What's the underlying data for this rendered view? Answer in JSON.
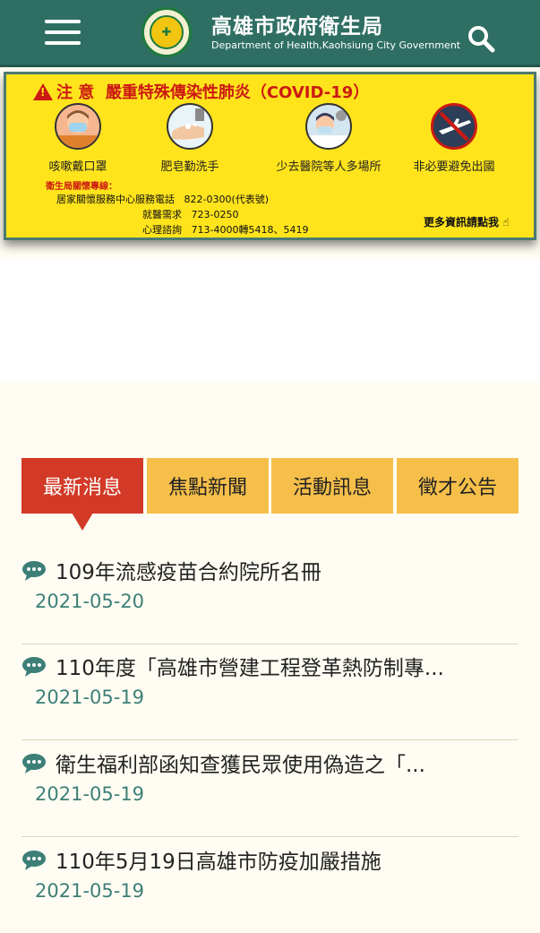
{
  "header": {
    "title": "高雄市政府衛生局",
    "subtitle": "Department of Health,Kaohsiung City Government",
    "menu_icon": "hamburger-menu-icon",
    "search_icon": "search-icon"
  },
  "banner": {
    "notice_label": "注 意",
    "headline": "嚴重特殊傳染性肺炎（COVID-19）",
    "tips": [
      {
        "label": "咳嗽戴口罩",
        "icon": "mask-person-icon"
      },
      {
        "label": "肥皂勤洗手",
        "icon": "hand-wash-icon"
      },
      {
        "label": "少去醫院等人多場所",
        "icon": "hospital-crowd-icon"
      },
      {
        "label": "非必要避免出國",
        "icon": "no-flight-icon"
      }
    ],
    "hotline_heading": "衛生局關懷專線：",
    "hotlines": [
      {
        "name": "居家關懷服務中心服務電話",
        "number": "822-0300(代表號)"
      },
      {
        "name": "就醫需求",
        "number": "723-0250"
      },
      {
        "name": "心理諮詢",
        "number": "713-4000轉5418、5419"
      }
    ],
    "more_link": "更多資訊請點我"
  },
  "tabs": [
    {
      "label": "最新消息",
      "active": true
    },
    {
      "label": "焦點新聞",
      "active": false
    },
    {
      "label": "活動訊息",
      "active": false
    },
    {
      "label": "徵才公告",
      "active": false
    }
  ],
  "news": [
    {
      "title": "109年流感疫苗合約院所名冊",
      "date": "2021-05-20"
    },
    {
      "title": "110年度「高雄市營建工程登革熱防制專...",
      "date": "2021-05-19"
    },
    {
      "title": "衛生福利部函知查獲民眾使用偽造之「...",
      "date": "2021-05-19"
    },
    {
      "title": "110年5月19日高雄市防疫加嚴措施",
      "date": "2021-05-19"
    }
  ],
  "colors": {
    "header_bg": "#2f6f63",
    "banner_bg": "#ffe41c",
    "alert_red": "#cc1a12",
    "tab_active": "#d23a27",
    "tab_inactive": "#f5bf4a",
    "date_teal": "#3d7f76"
  }
}
